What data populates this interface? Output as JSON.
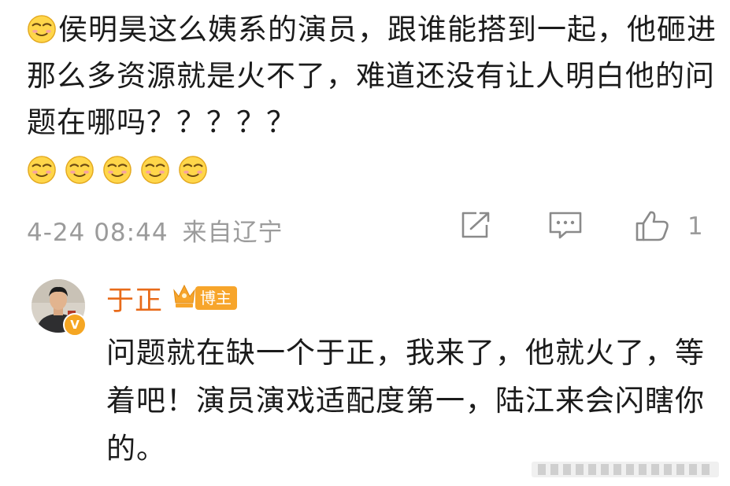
{
  "comment": {
    "text": "侯明昊这么姨系的演员，跟谁能搭到一起，他砸进那么多资源就是火不了，难道还没有让人明白他的问题在哪吗？？？？？",
    "date": "4-24 08:44",
    "location": "来自辽宁",
    "like_count": "1",
    "emoji_icon": "smirk-emoji-icon",
    "emoji_count": 6
  },
  "reply": {
    "author": "于正",
    "badge": "博主",
    "text": "问题就在缺一个于正，我来了，他就火了，等着吧！演员演戏适配度第一，陆江来会闪瞎你的。"
  },
  "colors": {
    "author_name": "#e86b1a",
    "badge_bg": "#f7a52b",
    "meta_text": "#9b9b9b",
    "verified_badge": "#f5a623"
  }
}
